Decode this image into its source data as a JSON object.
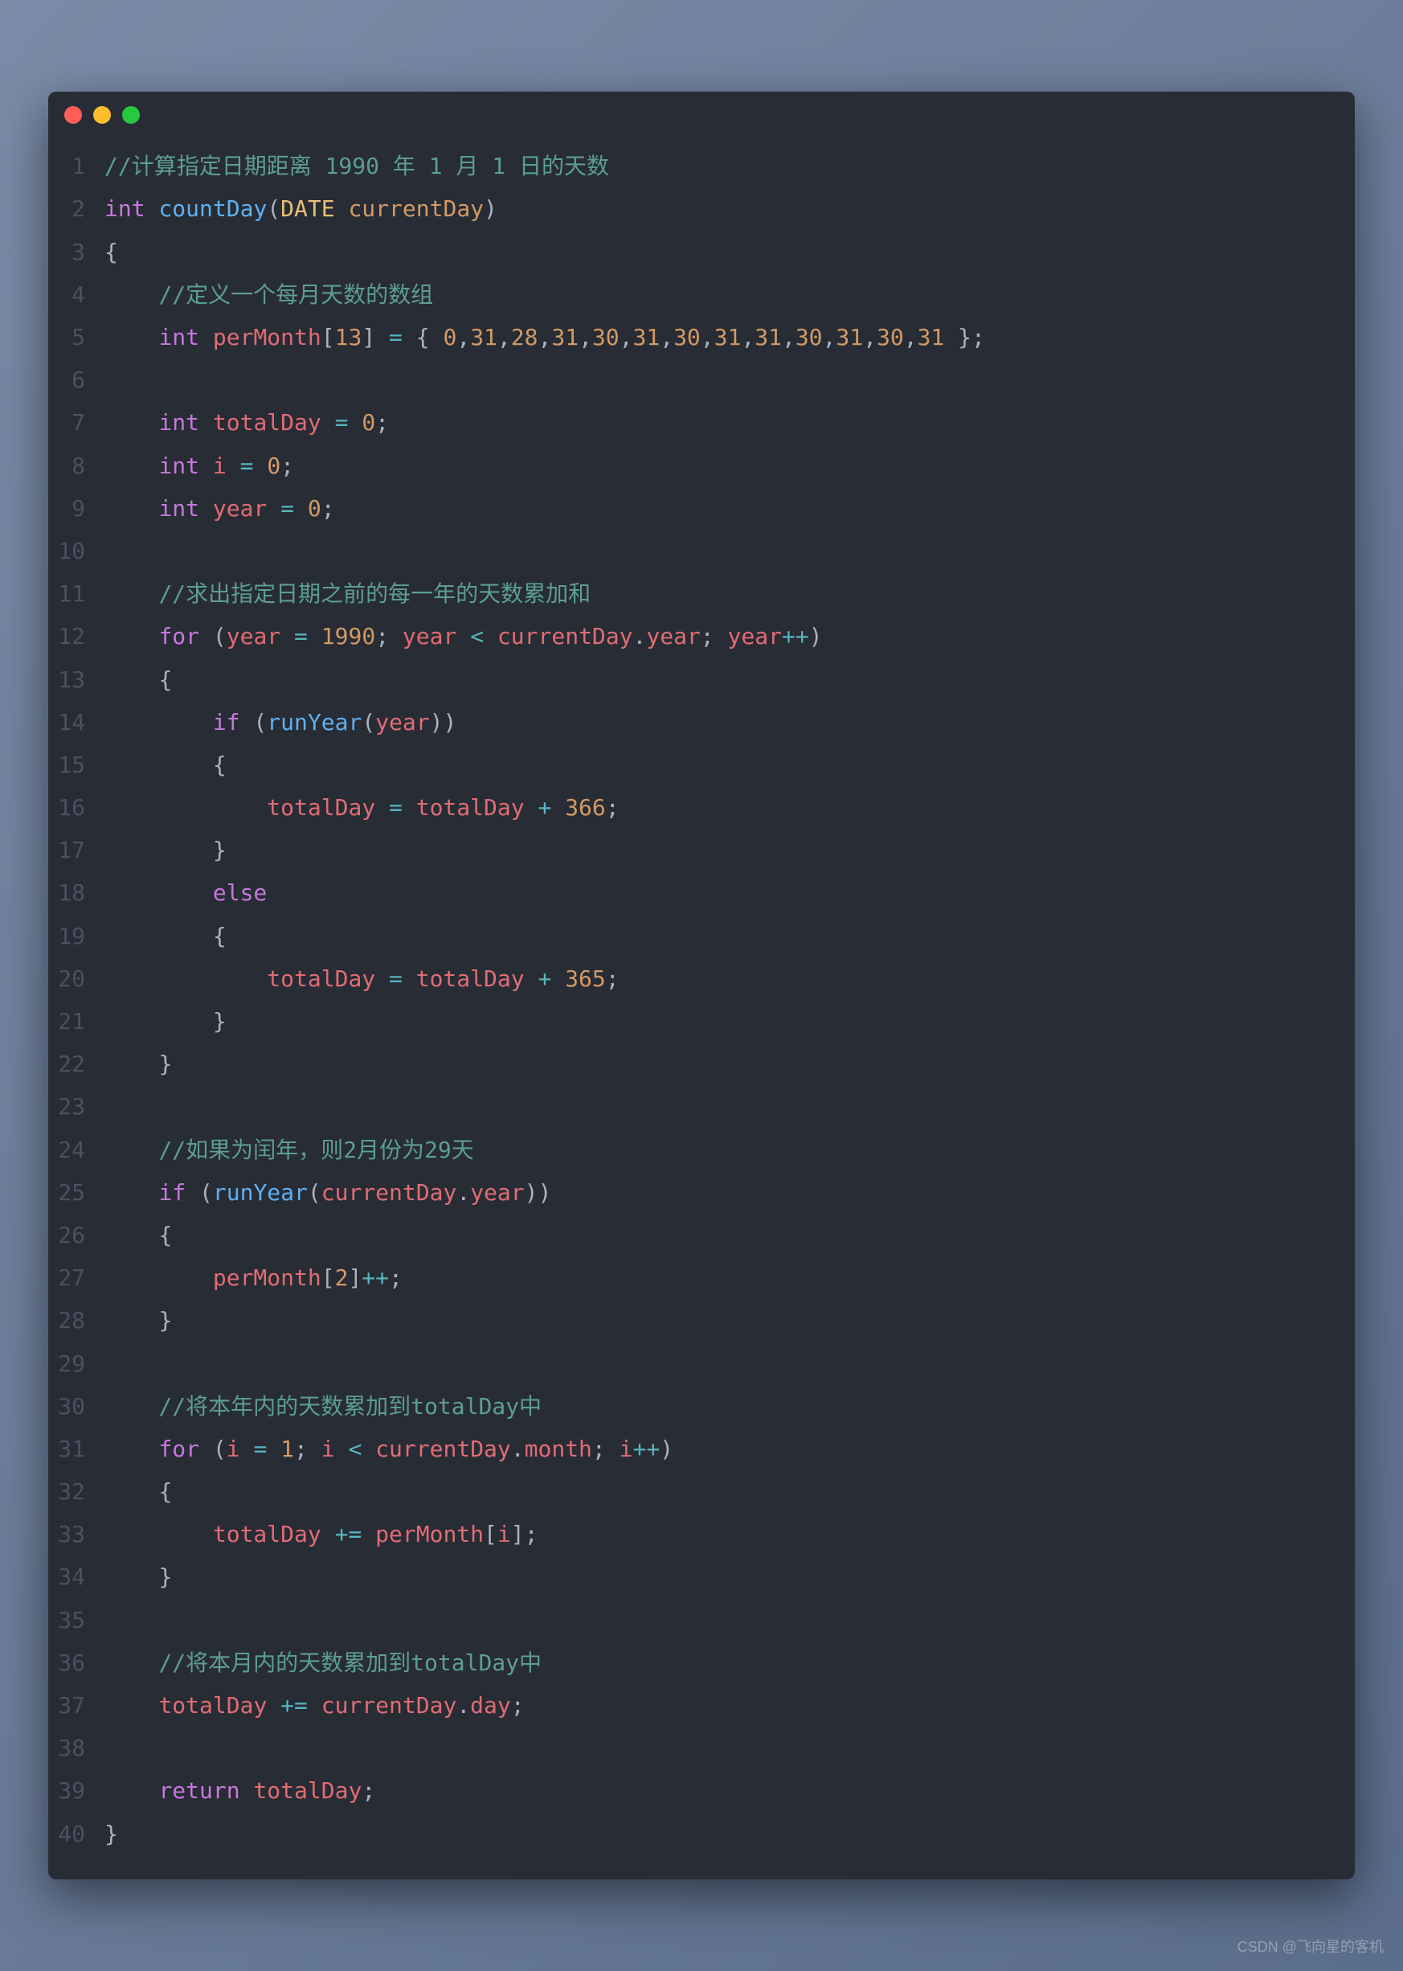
{
  "watermark": "CSDN @飞向星的客机",
  "lines": [
    {
      "n": "1",
      "tokens": [
        [
          "comment",
          "//计算指定日期距离 1990 年 1 月 1 日的天数"
        ]
      ]
    },
    {
      "n": "2",
      "tokens": [
        [
          "type",
          "int"
        ],
        [
          "punct",
          " "
        ],
        [
          "func",
          "countDay"
        ],
        [
          "punct",
          "("
        ],
        [
          "typename",
          "DATE"
        ],
        [
          "punct",
          " "
        ],
        [
          "param",
          "currentDay"
        ],
        [
          "punct",
          ")"
        ]
      ]
    },
    {
      "n": "3",
      "tokens": [
        [
          "brace",
          "{"
        ]
      ]
    },
    {
      "n": "4",
      "tokens": [
        [
          "punct",
          "    "
        ],
        [
          "comment",
          "//定义一个每月天数的数组"
        ]
      ]
    },
    {
      "n": "5",
      "tokens": [
        [
          "punct",
          "    "
        ],
        [
          "type",
          "int"
        ],
        [
          "punct",
          " "
        ],
        [
          "var",
          "perMonth"
        ],
        [
          "punct",
          "["
        ],
        [
          "number",
          "13"
        ],
        [
          "punct",
          "] "
        ],
        [
          "op",
          "="
        ],
        [
          "punct",
          " { "
        ],
        [
          "number",
          "0"
        ],
        [
          "punct",
          ","
        ],
        [
          "number",
          "31"
        ],
        [
          "punct",
          ","
        ],
        [
          "number",
          "28"
        ],
        [
          "punct",
          ","
        ],
        [
          "number",
          "31"
        ],
        [
          "punct",
          ","
        ],
        [
          "number",
          "30"
        ],
        [
          "punct",
          ","
        ],
        [
          "number",
          "31"
        ],
        [
          "punct",
          ","
        ],
        [
          "number",
          "30"
        ],
        [
          "punct",
          ","
        ],
        [
          "number",
          "31"
        ],
        [
          "punct",
          ","
        ],
        [
          "number",
          "31"
        ],
        [
          "punct",
          ","
        ],
        [
          "number",
          "30"
        ],
        [
          "punct",
          ","
        ],
        [
          "number",
          "31"
        ],
        [
          "punct",
          ","
        ],
        [
          "number",
          "30"
        ],
        [
          "punct",
          ","
        ],
        [
          "number",
          "31"
        ],
        [
          "punct",
          " };"
        ]
      ]
    },
    {
      "n": "6",
      "tokens": []
    },
    {
      "n": "7",
      "tokens": [
        [
          "punct",
          "    "
        ],
        [
          "type",
          "int"
        ],
        [
          "punct",
          " "
        ],
        [
          "var",
          "totalDay"
        ],
        [
          "punct",
          " "
        ],
        [
          "op",
          "="
        ],
        [
          "punct",
          " "
        ],
        [
          "number",
          "0"
        ],
        [
          "punct",
          ";"
        ]
      ]
    },
    {
      "n": "8",
      "tokens": [
        [
          "punct",
          "    "
        ],
        [
          "type",
          "int"
        ],
        [
          "punct",
          " "
        ],
        [
          "var",
          "i"
        ],
        [
          "punct",
          " "
        ],
        [
          "op",
          "="
        ],
        [
          "punct",
          " "
        ],
        [
          "number",
          "0"
        ],
        [
          "punct",
          ";"
        ]
      ]
    },
    {
      "n": "9",
      "tokens": [
        [
          "punct",
          "    "
        ],
        [
          "type",
          "int"
        ],
        [
          "punct",
          " "
        ],
        [
          "var",
          "year"
        ],
        [
          "punct",
          " "
        ],
        [
          "op",
          "="
        ],
        [
          "punct",
          " "
        ],
        [
          "number",
          "0"
        ],
        [
          "punct",
          ";"
        ]
      ]
    },
    {
      "n": "10",
      "tokens": []
    },
    {
      "n": "11",
      "tokens": [
        [
          "punct",
          "    "
        ],
        [
          "comment",
          "//求出指定日期之前的每一年的天数累加和"
        ]
      ]
    },
    {
      "n": "12",
      "tokens": [
        [
          "punct",
          "    "
        ],
        [
          "keyword",
          "for"
        ],
        [
          "punct",
          " ("
        ],
        [
          "var",
          "year"
        ],
        [
          "punct",
          " "
        ],
        [
          "op",
          "="
        ],
        [
          "punct",
          " "
        ],
        [
          "number",
          "1990"
        ],
        [
          "punct",
          "; "
        ],
        [
          "var",
          "year"
        ],
        [
          "punct",
          " "
        ],
        [
          "op",
          "<"
        ],
        [
          "punct",
          " "
        ],
        [
          "var",
          "currentDay"
        ],
        [
          "punct",
          "."
        ],
        [
          "var",
          "year"
        ],
        [
          "punct",
          "; "
        ],
        [
          "var",
          "year"
        ],
        [
          "op",
          "++"
        ],
        [
          "punct",
          ")"
        ]
      ]
    },
    {
      "n": "13",
      "tokens": [
        [
          "punct",
          "    "
        ],
        [
          "brace",
          "{"
        ]
      ]
    },
    {
      "n": "14",
      "tokens": [
        [
          "punct",
          "        "
        ],
        [
          "keyword",
          "if"
        ],
        [
          "punct",
          " ("
        ],
        [
          "func",
          "runYear"
        ],
        [
          "punct",
          "("
        ],
        [
          "var",
          "year"
        ],
        [
          "punct",
          "))"
        ]
      ]
    },
    {
      "n": "15",
      "tokens": [
        [
          "punct",
          "        "
        ],
        [
          "brace",
          "{"
        ]
      ]
    },
    {
      "n": "16",
      "tokens": [
        [
          "punct",
          "            "
        ],
        [
          "var",
          "totalDay"
        ],
        [
          "punct",
          " "
        ],
        [
          "op",
          "="
        ],
        [
          "punct",
          " "
        ],
        [
          "var",
          "totalDay"
        ],
        [
          "punct",
          " "
        ],
        [
          "op",
          "+"
        ],
        [
          "punct",
          " "
        ],
        [
          "number",
          "366"
        ],
        [
          "punct",
          ";"
        ]
      ]
    },
    {
      "n": "17",
      "tokens": [
        [
          "punct",
          "        "
        ],
        [
          "brace",
          "}"
        ]
      ]
    },
    {
      "n": "18",
      "tokens": [
        [
          "punct",
          "        "
        ],
        [
          "keyword",
          "else"
        ]
      ]
    },
    {
      "n": "19",
      "tokens": [
        [
          "punct",
          "        "
        ],
        [
          "brace",
          "{"
        ]
      ]
    },
    {
      "n": "20",
      "tokens": [
        [
          "punct",
          "            "
        ],
        [
          "var",
          "totalDay"
        ],
        [
          "punct",
          " "
        ],
        [
          "op",
          "="
        ],
        [
          "punct",
          " "
        ],
        [
          "var",
          "totalDay"
        ],
        [
          "punct",
          " "
        ],
        [
          "op",
          "+"
        ],
        [
          "punct",
          " "
        ],
        [
          "number",
          "365"
        ],
        [
          "punct",
          ";"
        ]
      ]
    },
    {
      "n": "21",
      "tokens": [
        [
          "punct",
          "        "
        ],
        [
          "brace",
          "}"
        ]
      ]
    },
    {
      "n": "22",
      "tokens": [
        [
          "punct",
          "    "
        ],
        [
          "brace",
          "}"
        ]
      ]
    },
    {
      "n": "23",
      "tokens": []
    },
    {
      "n": "24",
      "tokens": [
        [
          "punct",
          "    "
        ],
        [
          "comment",
          "//如果为闰年，则2月份为29天"
        ]
      ]
    },
    {
      "n": "25",
      "tokens": [
        [
          "punct",
          "    "
        ],
        [
          "keyword",
          "if"
        ],
        [
          "punct",
          " ("
        ],
        [
          "func",
          "runYear"
        ],
        [
          "punct",
          "("
        ],
        [
          "var",
          "currentDay"
        ],
        [
          "punct",
          "."
        ],
        [
          "var",
          "year"
        ],
        [
          "punct",
          "))"
        ]
      ]
    },
    {
      "n": "26",
      "tokens": [
        [
          "punct",
          "    "
        ],
        [
          "brace",
          "{"
        ]
      ]
    },
    {
      "n": "27",
      "tokens": [
        [
          "punct",
          "        "
        ],
        [
          "var",
          "perMonth"
        ],
        [
          "punct",
          "["
        ],
        [
          "number",
          "2"
        ],
        [
          "punct",
          "]"
        ],
        [
          "op",
          "++"
        ],
        [
          "punct",
          ";"
        ]
      ]
    },
    {
      "n": "28",
      "tokens": [
        [
          "punct",
          "    "
        ],
        [
          "brace",
          "}"
        ]
      ]
    },
    {
      "n": "29",
      "tokens": []
    },
    {
      "n": "30",
      "tokens": [
        [
          "punct",
          "    "
        ],
        [
          "comment",
          "//将本年内的天数累加到totalDay中"
        ]
      ]
    },
    {
      "n": "31",
      "tokens": [
        [
          "punct",
          "    "
        ],
        [
          "keyword",
          "for"
        ],
        [
          "punct",
          " ("
        ],
        [
          "var",
          "i"
        ],
        [
          "punct",
          " "
        ],
        [
          "op",
          "="
        ],
        [
          "punct",
          " "
        ],
        [
          "number",
          "1"
        ],
        [
          "punct",
          "; "
        ],
        [
          "var",
          "i"
        ],
        [
          "punct",
          " "
        ],
        [
          "op",
          "<"
        ],
        [
          "punct",
          " "
        ],
        [
          "var",
          "currentDay"
        ],
        [
          "punct",
          "."
        ],
        [
          "var",
          "month"
        ],
        [
          "punct",
          "; "
        ],
        [
          "var",
          "i"
        ],
        [
          "op",
          "++"
        ],
        [
          "punct",
          ")"
        ]
      ]
    },
    {
      "n": "32",
      "tokens": [
        [
          "punct",
          "    "
        ],
        [
          "brace",
          "{"
        ]
      ]
    },
    {
      "n": "33",
      "tokens": [
        [
          "punct",
          "        "
        ],
        [
          "var",
          "totalDay"
        ],
        [
          "punct",
          " "
        ],
        [
          "op",
          "+="
        ],
        [
          "punct",
          " "
        ],
        [
          "var",
          "perMonth"
        ],
        [
          "punct",
          "["
        ],
        [
          "var",
          "i"
        ],
        [
          "punct",
          "];"
        ]
      ]
    },
    {
      "n": "34",
      "tokens": [
        [
          "punct",
          "    "
        ],
        [
          "brace",
          "}"
        ]
      ]
    },
    {
      "n": "35",
      "tokens": []
    },
    {
      "n": "36",
      "tokens": [
        [
          "punct",
          "    "
        ],
        [
          "comment",
          "//将本月内的天数累加到totalDay中"
        ]
      ]
    },
    {
      "n": "37",
      "tokens": [
        [
          "punct",
          "    "
        ],
        [
          "var",
          "totalDay"
        ],
        [
          "punct",
          " "
        ],
        [
          "op",
          "+="
        ],
        [
          "punct",
          " "
        ],
        [
          "var",
          "currentDay"
        ],
        [
          "punct",
          "."
        ],
        [
          "var",
          "day"
        ],
        [
          "punct",
          ";"
        ]
      ]
    },
    {
      "n": "38",
      "tokens": []
    },
    {
      "n": "39",
      "tokens": [
        [
          "punct",
          "    "
        ],
        [
          "keyword",
          "return"
        ],
        [
          "punct",
          " "
        ],
        [
          "var",
          "totalDay"
        ],
        [
          "punct",
          ";"
        ]
      ]
    },
    {
      "n": "40",
      "tokens": [
        [
          "brace",
          "}"
        ]
      ]
    }
  ]
}
